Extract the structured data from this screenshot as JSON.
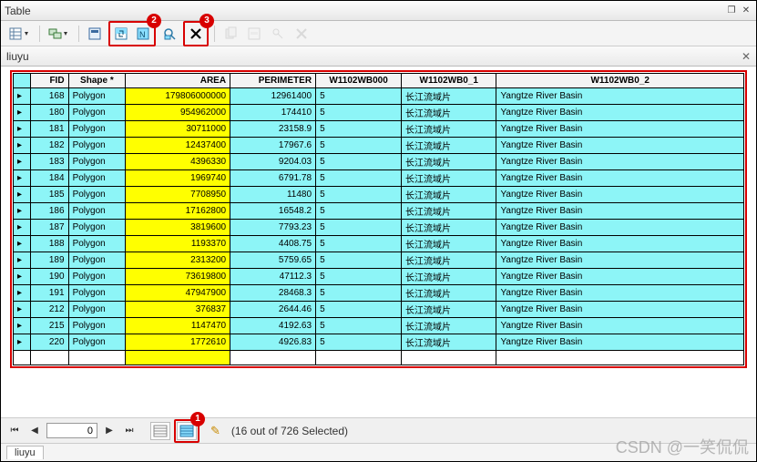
{
  "window": {
    "title": "Table"
  },
  "toolbar": {
    "btn_list": "table-options-icon",
    "btn_related": "related-tables-icon",
    "btn_select_by_attr": "select-by-attributes-icon",
    "btn_switch": "switch-selection-icon",
    "btn_zoom": "zoom-to-selected-icon",
    "btn_clear": "clear-selection-icon"
  },
  "badges": {
    "b1": "1",
    "b2": "2",
    "b3": "3"
  },
  "tab": {
    "name": "liuyu"
  },
  "columns": [
    "FID",
    "Shape *",
    "AREA",
    "PERIMETER",
    "W1102WB000",
    "W1102WB0_1",
    "W1102WB0_2"
  ],
  "rows": [
    {
      "fid": "168",
      "shape": "Polygon",
      "area": "179806000000",
      "perim": "12961400",
      "w000": "5",
      "w01": "长江流域片",
      "w02": "Yangtze River Basin"
    },
    {
      "fid": "180",
      "shape": "Polygon",
      "area": "954962000",
      "perim": "174410",
      "w000": "5",
      "w01": "长江流域片",
      "w02": "Yangtze River Basin"
    },
    {
      "fid": "181",
      "shape": "Polygon",
      "area": "30711000",
      "perim": "23158.9",
      "w000": "5",
      "w01": "长江流域片",
      "w02": "Yangtze River Basin"
    },
    {
      "fid": "182",
      "shape": "Polygon",
      "area": "12437400",
      "perim": "17967.6",
      "w000": "5",
      "w01": "长江流域片",
      "w02": "Yangtze River Basin"
    },
    {
      "fid": "183",
      "shape": "Polygon",
      "area": "4396330",
      "perim": "9204.03",
      "w000": "5",
      "w01": "长江流域片",
      "w02": "Yangtze River Basin"
    },
    {
      "fid": "184",
      "shape": "Polygon",
      "area": "1969740",
      "perim": "6791.78",
      "w000": "5",
      "w01": "长江流域片",
      "w02": "Yangtze River Basin"
    },
    {
      "fid": "185",
      "shape": "Polygon",
      "area": "7708950",
      "perim": "11480",
      "w000": "5",
      "w01": "长江流域片",
      "w02": "Yangtze River Basin"
    },
    {
      "fid": "186",
      "shape": "Polygon",
      "area": "17162800",
      "perim": "16548.2",
      "w000": "5",
      "w01": "长江流域片",
      "w02": "Yangtze River Basin"
    },
    {
      "fid": "187",
      "shape": "Polygon",
      "area": "3819600",
      "perim": "7793.23",
      "w000": "5",
      "w01": "长江流域片",
      "w02": "Yangtze River Basin"
    },
    {
      "fid": "188",
      "shape": "Polygon",
      "area": "1193370",
      "perim": "4408.75",
      "w000": "5",
      "w01": "长江流域片",
      "w02": "Yangtze River Basin"
    },
    {
      "fid": "189",
      "shape": "Polygon",
      "area": "2313200",
      "perim": "5759.65",
      "w000": "5",
      "w01": "长江流域片",
      "w02": "Yangtze River Basin"
    },
    {
      "fid": "190",
      "shape": "Polygon",
      "area": "73619800",
      "perim": "47112.3",
      "w000": "5",
      "w01": "长江流域片",
      "w02": "Yangtze River Basin"
    },
    {
      "fid": "191",
      "shape": "Polygon",
      "area": "47947900",
      "perim": "28468.3",
      "w000": "5",
      "w01": "长江流域片",
      "w02": "Yangtze River Basin"
    },
    {
      "fid": "212",
      "shape": "Polygon",
      "area": "376837",
      "perim": "2644.46",
      "w000": "5",
      "w01": "长江流域片",
      "w02": "Yangtze River Basin"
    },
    {
      "fid": "215",
      "shape": "Polygon",
      "area": "1147470",
      "perim": "4192.63",
      "w000": "5",
      "w01": "长江流域片",
      "w02": "Yangtze River Basin"
    },
    {
      "fid": "220",
      "shape": "Polygon",
      "area": "1772610",
      "perim": "4926.83",
      "w000": "5",
      "w01": "长江流域片",
      "w02": "Yangtze River Basin"
    }
  ],
  "nav": {
    "record": "0",
    "status": "(16 out of 726 Selected)"
  },
  "bottomtab": {
    "name": "liuyu"
  },
  "watermark": "CSDN @一笑侃侃"
}
